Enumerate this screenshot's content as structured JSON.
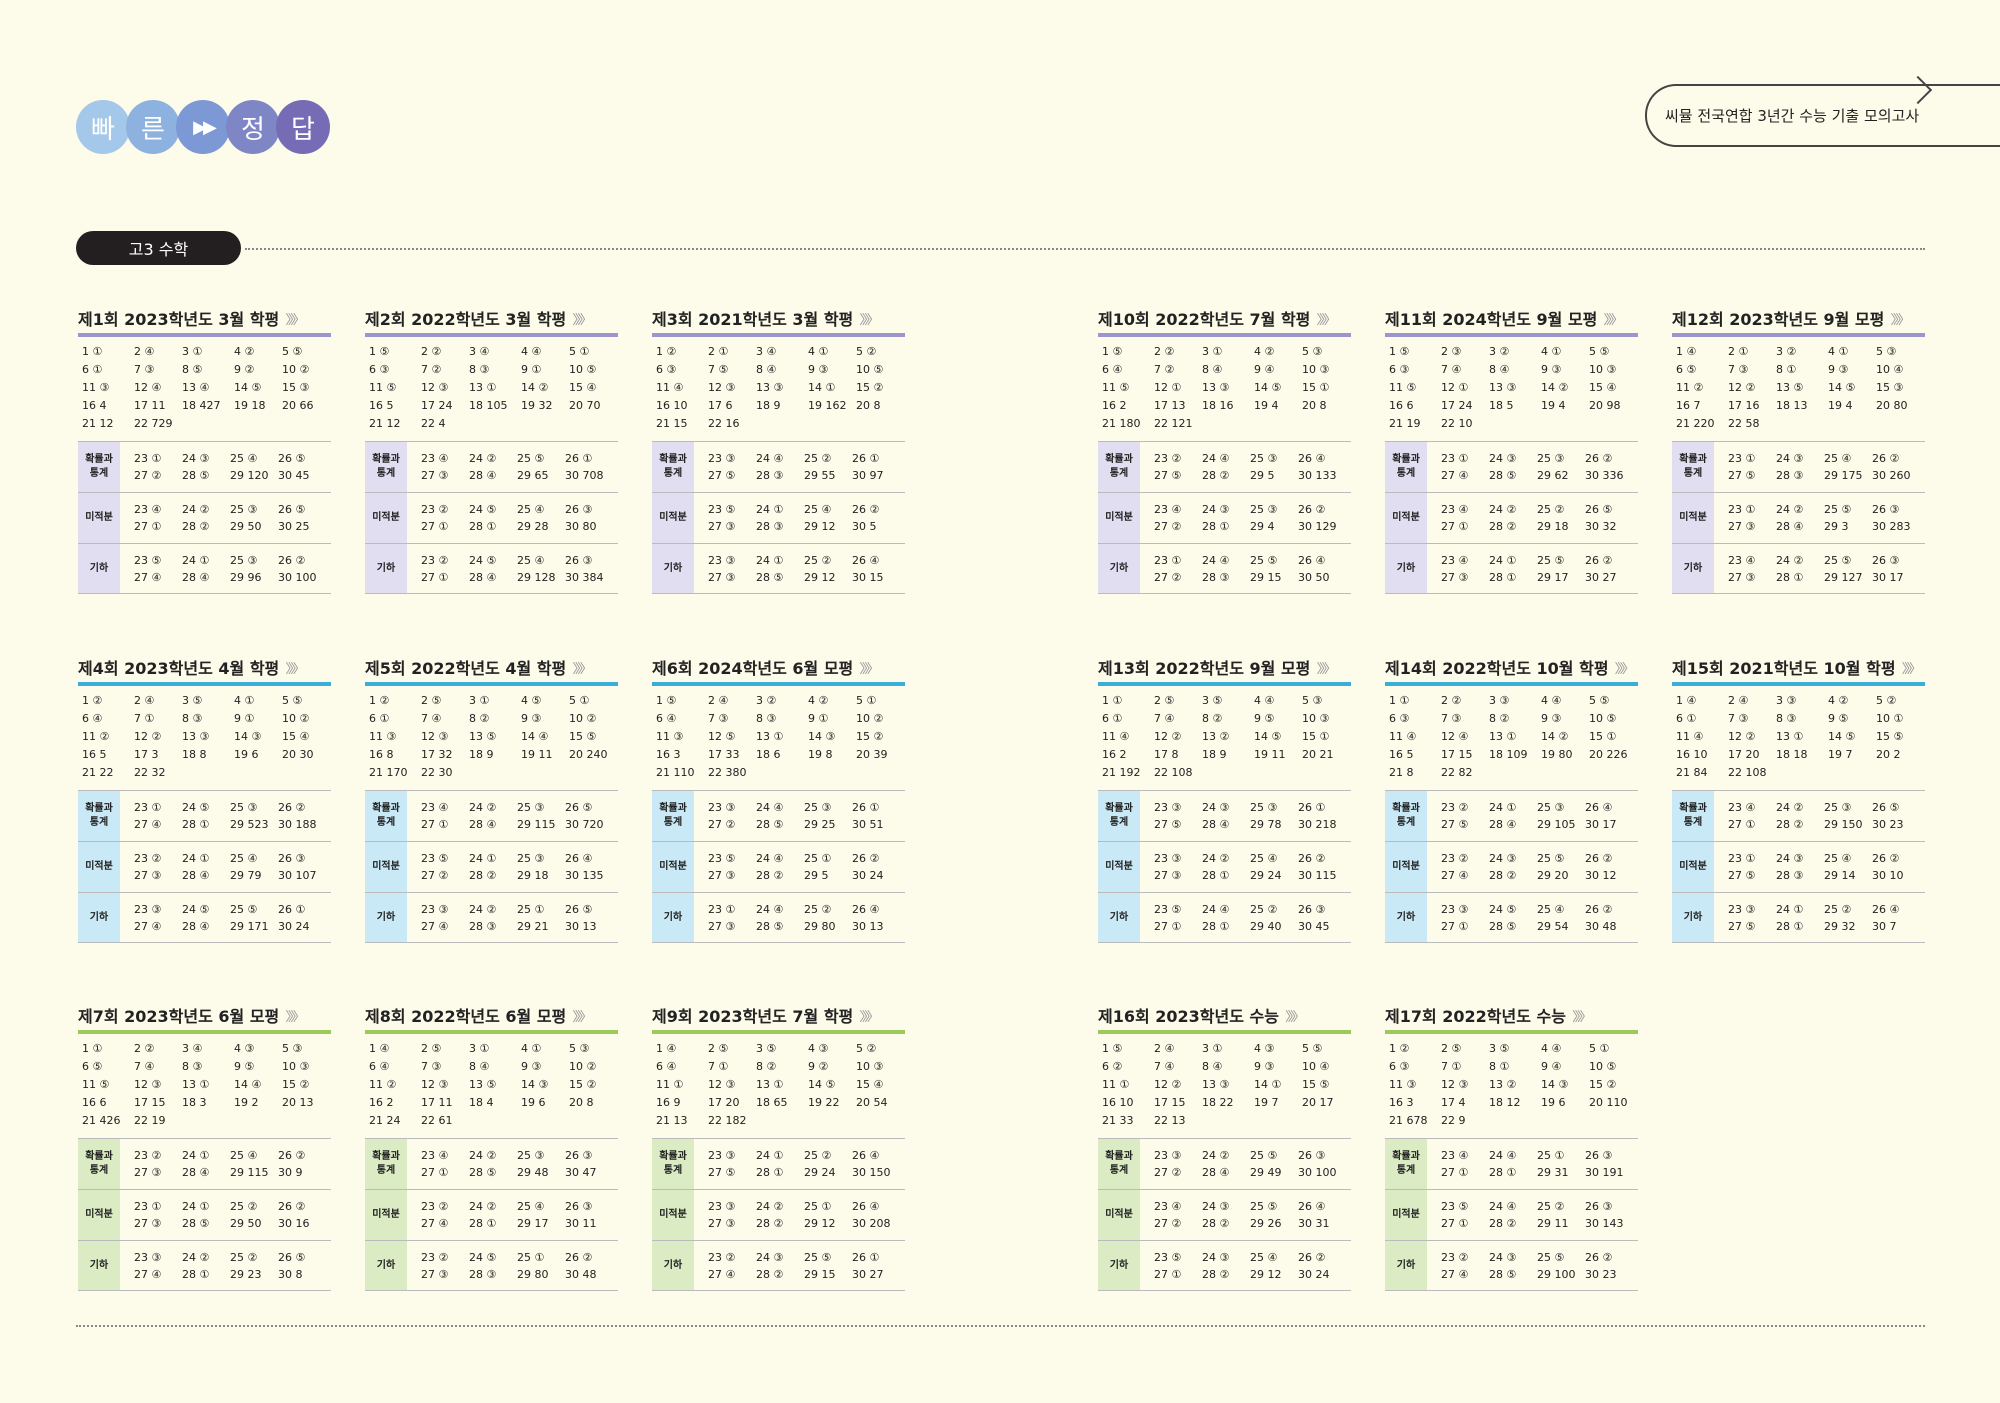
{
  "header": {
    "chars": [
      "빠",
      "른",
      "▶▶",
      "정",
      "답"
    ],
    "series": "씨뮬 전국연합 3년간 수능 기출 모의고사",
    "subject": "고3 수학"
  },
  "labels": {
    "s1": "확률과\n통계",
    "s2": "미적분",
    "s3": "기하"
  },
  "blocks": [
    {
      "title": "제1회 2023학년도 3월 학평",
      "theme": "purple",
      "col": 0,
      "row": 0,
      "common": [
        "1 ①",
        "2 ④",
        "3 ①",
        "4 ②",
        "5 ⑤",
        "6 ①",
        "7 ③",
        "8 ⑤",
        "9 ②",
        "10 ②",
        "11 ③",
        "12 ④",
        "13 ④",
        "14 ⑤",
        "15 ③",
        "16 4",
        "17 11",
        "18 427",
        "19 18",
        "20 66",
        "21 12",
        "22 729"
      ],
      "s1": [
        "23 ①",
        "24 ③",
        "25 ④",
        "26 ⑤",
        "27 ②",
        "28 ⑤",
        "29 120",
        "30 45"
      ],
      "s2": [
        "23 ④",
        "24 ②",
        "25 ③",
        "26 ⑤",
        "27 ①",
        "28 ②",
        "29 50",
        "30 25"
      ],
      "s3": [
        "23 ⑤",
        "24 ①",
        "25 ③",
        "26 ②",
        "27 ④",
        "28 ④",
        "29 96",
        "30 100"
      ]
    },
    {
      "title": "제2회 2022학년도 3월 학평",
      "theme": "purple",
      "col": 1,
      "row": 0,
      "common": [
        "1 ⑤",
        "2 ②",
        "3 ④",
        "4 ④",
        "5 ①",
        "6 ③",
        "7 ②",
        "8 ③",
        "9 ①",
        "10 ⑤",
        "11 ⑤",
        "12 ③",
        "13 ①",
        "14 ②",
        "15 ④",
        "16 5",
        "17 24",
        "18 105",
        "19 32",
        "20 70",
        "21 12",
        "22 4"
      ],
      "s1": [
        "23 ④",
        "24 ②",
        "25 ⑤",
        "26 ①",
        "27 ③",
        "28 ④",
        "29 65",
        "30 708"
      ],
      "s2": [
        "23 ②",
        "24 ⑤",
        "25 ④",
        "26 ③",
        "27 ①",
        "28 ①",
        "29 28",
        "30 80"
      ],
      "s3": [
        "23 ②",
        "24 ⑤",
        "25 ④",
        "26 ③",
        "27 ①",
        "28 ④",
        "29 128",
        "30 384"
      ]
    },
    {
      "title": "제3회 2021학년도 3월 학평",
      "theme": "purple",
      "col": 2,
      "row": 0,
      "common": [
        "1 ②",
        "2 ①",
        "3 ④",
        "4 ①",
        "5 ②",
        "6 ③",
        "7 ⑤",
        "8 ④",
        "9 ③",
        "10 ⑤",
        "11 ④",
        "12 ③",
        "13 ③",
        "14 ①",
        "15 ②",
        "16 10",
        "17 6",
        "18 9",
        "19 162",
        "20 8",
        "21 15",
        "22 16"
      ],
      "s1": [
        "23 ③",
        "24 ④",
        "25 ②",
        "26 ①",
        "27 ⑤",
        "28 ③",
        "29 55",
        "30 97"
      ],
      "s2": [
        "23 ⑤",
        "24 ①",
        "25 ④",
        "26 ②",
        "27 ③",
        "28 ③",
        "29 12",
        "30 5"
      ],
      "s3": [
        "23 ③",
        "24 ①",
        "25 ②",
        "26 ④",
        "27 ③",
        "28 ⑤",
        "29 12",
        "30 15"
      ]
    },
    {
      "title": "제4회 2023학년도 4월 학평",
      "theme": "blue",
      "col": 0,
      "row": 1,
      "common": [
        "1 ②",
        "2 ④",
        "3 ⑤",
        "4 ①",
        "5 ⑤",
        "6 ④",
        "7 ①",
        "8 ③",
        "9 ①",
        "10 ②",
        "11 ②",
        "12 ②",
        "13 ③",
        "14 ③",
        "15 ④",
        "16 5",
        "17 3",
        "18 8",
        "19 6",
        "20 30",
        "21 22",
        "22 32"
      ],
      "s1": [
        "23 ①",
        "24 ⑤",
        "25 ③",
        "26 ②",
        "27 ④",
        "28 ①",
        "29 523",
        "30 188"
      ],
      "s2": [
        "23 ②",
        "24 ①",
        "25 ④",
        "26 ③",
        "27 ③",
        "28 ④",
        "29 79",
        "30 107"
      ],
      "s3": [
        "23 ③",
        "24 ⑤",
        "25 ⑤",
        "26 ①",
        "27 ④",
        "28 ④",
        "29 171",
        "30 24"
      ]
    },
    {
      "title": "제5회 2022학년도 4월 학평",
      "theme": "blue",
      "col": 1,
      "row": 1,
      "common": [
        "1 ②",
        "2 ⑤",
        "3 ①",
        "4 ⑤",
        "5 ①",
        "6 ①",
        "7 ④",
        "8 ②",
        "9 ③",
        "10 ②",
        "11 ③",
        "12 ③",
        "13 ⑤",
        "14 ④",
        "15 ⑤",
        "16 8",
        "17 32",
        "18 9",
        "19 11",
        "20 240",
        "21 170",
        "22 30"
      ],
      "s1": [
        "23 ④",
        "24 ②",
        "25 ③",
        "26 ⑤",
        "27 ①",
        "28 ④",
        "29 115",
        "30 720"
      ],
      "s2": [
        "23 ⑤",
        "24 ①",
        "25 ③",
        "26 ④",
        "27 ②",
        "28 ②",
        "29 18",
        "30 135"
      ],
      "s3": [
        "23 ③",
        "24 ②",
        "25 ①",
        "26 ⑤",
        "27 ④",
        "28 ③",
        "29 21",
        "30 13"
      ]
    },
    {
      "title": "제6회 2024학년도 6월 모평",
      "theme": "blue",
      "col": 2,
      "row": 1,
      "common": [
        "1 ⑤",
        "2 ④",
        "3 ②",
        "4 ②",
        "5 ①",
        "6 ④",
        "7 ③",
        "8 ③",
        "9 ①",
        "10 ②",
        "11 ③",
        "12 ⑤",
        "13 ①",
        "14 ③",
        "15 ②",
        "16 3",
        "17 33",
        "18 6",
        "19 8",
        "20 39",
        "21 110",
        "22 380"
      ],
      "s1": [
        "23 ③",
        "24 ④",
        "25 ③",
        "26 ①",
        "27 ②",
        "28 ⑤",
        "29 25",
        "30 51"
      ],
      "s2": [
        "23 ⑤",
        "24 ④",
        "25 ①",
        "26 ②",
        "27 ③",
        "28 ②",
        "29 5",
        "30 24"
      ],
      "s3": [
        "23 ①",
        "24 ④",
        "25 ②",
        "26 ④",
        "27 ③",
        "28 ⑤",
        "29 80",
        "30 13"
      ]
    },
    {
      "title": "제7회 2023학년도 6월 모평",
      "theme": "green",
      "col": 0,
      "row": 2,
      "common": [
        "1 ①",
        "2 ②",
        "3 ④",
        "4 ③",
        "5 ③",
        "6 ⑤",
        "7 ④",
        "8 ③",
        "9 ⑤",
        "10 ③",
        "11 ⑤",
        "12 ③",
        "13 ①",
        "14 ④",
        "15 ②",
        "16 6",
        "17 15",
        "18 3",
        "19 2",
        "20 13",
        "21 426",
        "22 19"
      ],
      "s1": [
        "23 ②",
        "24 ①",
        "25 ④",
        "26 ②",
        "27 ③",
        "28 ④",
        "29 115",
        "30 9"
      ],
      "s2": [
        "23 ①",
        "24 ①",
        "25 ②",
        "26 ②",
        "27 ③",
        "28 ⑤",
        "29 50",
        "30 16"
      ],
      "s3": [
        "23 ③",
        "24 ②",
        "25 ②",
        "26 ⑤",
        "27 ④",
        "28 ①",
        "29 23",
        "30 8"
      ]
    },
    {
      "title": "제8회 2022학년도 6월 모평",
      "theme": "green",
      "col": 1,
      "row": 2,
      "common": [
        "1 ④",
        "2 ⑤",
        "3 ①",
        "4 ①",
        "5 ③",
        "6 ④",
        "7 ③",
        "8 ④",
        "9 ③",
        "10 ②",
        "11 ②",
        "12 ③",
        "13 ⑤",
        "14 ③",
        "15 ②",
        "16 2",
        "17 11",
        "18 4",
        "19 6",
        "20 8",
        "21 24",
        "22 61"
      ],
      "s1": [
        "23 ④",
        "24 ②",
        "25 ③",
        "26 ③",
        "27 ①",
        "28 ⑤",
        "29 48",
        "30 47"
      ],
      "s2": [
        "23 ②",
        "24 ②",
        "25 ④",
        "26 ③",
        "27 ④",
        "28 ①",
        "29 17",
        "30 11"
      ],
      "s3": [
        "23 ②",
        "24 ⑤",
        "25 ①",
        "26 ②",
        "27 ③",
        "28 ③",
        "29 80",
        "30 48"
      ]
    },
    {
      "title": "제9회 2023학년도 7월 학평",
      "theme": "green",
      "col": 2,
      "row": 2,
      "common": [
        "1 ④",
        "2 ⑤",
        "3 ⑤",
        "4 ③",
        "5 ②",
        "6 ④",
        "7 ①",
        "8 ②",
        "9 ②",
        "10 ③",
        "11 ①",
        "12 ③",
        "13 ①",
        "14 ⑤",
        "15 ④",
        "16 9",
        "17 20",
        "18 65",
        "19 22",
        "20 54",
        "21 13",
        "22 182"
      ],
      "s1": [
        "23 ③",
        "24 ①",
        "25 ②",
        "26 ④",
        "27 ⑤",
        "28 ①",
        "29 24",
        "30 150"
      ],
      "s2": [
        "23 ③",
        "24 ②",
        "25 ①",
        "26 ④",
        "27 ③",
        "28 ②",
        "29 12",
        "30 208"
      ],
      "s3": [
        "23 ②",
        "24 ③",
        "25 ⑤",
        "26 ①",
        "27 ④",
        "28 ②",
        "29 15",
        "30 27"
      ]
    },
    {
      "title": "제10회 2022학년도 7월 학평",
      "theme": "purple",
      "col": 3,
      "row": 0,
      "common": [
        "1 ⑤",
        "2 ②",
        "3 ①",
        "4 ②",
        "5 ③",
        "6 ④",
        "7 ②",
        "8 ④",
        "9 ④",
        "10 ③",
        "11 ⑤",
        "12 ①",
        "13 ③",
        "14 ⑤",
        "15 ①",
        "16 2",
        "17 13",
        "18 16",
        "19 4",
        "20 8",
        "21 180",
        "22 121"
      ],
      "s1": [
        "23 ②",
        "24 ④",
        "25 ③",
        "26 ④",
        "27 ⑤",
        "28 ②",
        "29 5",
        "30 133"
      ],
      "s2": [
        "23 ④",
        "24 ③",
        "25 ③",
        "26 ②",
        "27 ②",
        "28 ①",
        "29 4",
        "30 129"
      ],
      "s3": [
        "23 ①",
        "24 ④",
        "25 ⑤",
        "26 ④",
        "27 ②",
        "28 ③",
        "29 15",
        "30 50"
      ]
    },
    {
      "title": "제11회 2024학년도 9월 모평",
      "theme": "purple",
      "col": 4,
      "row": 0,
      "common": [
        "1 ⑤",
        "2 ③",
        "3 ②",
        "4 ①",
        "5 ⑤",
        "6 ③",
        "7 ④",
        "8 ④",
        "9 ③",
        "10 ③",
        "11 ⑤",
        "12 ①",
        "13 ③",
        "14 ②",
        "15 ④",
        "16 6",
        "17 24",
        "18 5",
        "19 4",
        "20 98",
        "21 19",
        "22 10"
      ],
      "s1": [
        "23 ①",
        "24 ③",
        "25 ③",
        "26 ②",
        "27 ④",
        "28 ⑤",
        "29 62",
        "30 336"
      ],
      "s2": [
        "23 ④",
        "24 ②",
        "25 ②",
        "26 ⑤",
        "27 ①",
        "28 ②",
        "29 18",
        "30 32"
      ],
      "s3": [
        "23 ④",
        "24 ①",
        "25 ⑤",
        "26 ②",
        "27 ③",
        "28 ①",
        "29 17",
        "30 27"
      ]
    },
    {
      "title": "제12회 2023학년도 9월 모평",
      "theme": "purple",
      "col": 5,
      "row": 0,
      "common": [
        "1 ④",
        "2 ①",
        "3 ②",
        "4 ①",
        "5 ③",
        "6 ⑤",
        "7 ③",
        "8 ①",
        "9 ③",
        "10 ④",
        "11 ②",
        "12 ②",
        "13 ⑤",
        "14 ⑤",
        "15 ③",
        "16 7",
        "17 16",
        "18 13",
        "19 4",
        "20 80",
        "21 220",
        "22 58"
      ],
      "s1": [
        "23 ①",
        "24 ③",
        "25 ④",
        "26 ②",
        "27 ⑤",
        "28 ③",
        "29 175",
        "30 260"
      ],
      "s2": [
        "23 ①",
        "24 ②",
        "25 ⑤",
        "26 ③",
        "27 ③",
        "28 ④",
        "29 3",
        "30 283"
      ],
      "s3": [
        "23 ④",
        "24 ②",
        "25 ⑤",
        "26 ③",
        "27 ③",
        "28 ①",
        "29 127",
        "30 17"
      ]
    },
    {
      "title": "제13회 2022학년도 9월 모평",
      "theme": "blue",
      "col": 3,
      "row": 1,
      "common": [
        "1 ①",
        "2 ⑤",
        "3 ⑤",
        "4 ④",
        "5 ③",
        "6 ①",
        "7 ④",
        "8 ②",
        "9 ⑤",
        "10 ③",
        "11 ④",
        "12 ②",
        "13 ②",
        "14 ⑤",
        "15 ①",
        "16 2",
        "17 8",
        "18 9",
        "19 11",
        "20 21",
        "21 192",
        "22 108"
      ],
      "s1": [
        "23 ③",
        "24 ③",
        "25 ③",
        "26 ①",
        "27 ⑤",
        "28 ④",
        "29 78",
        "30 218"
      ],
      "s2": [
        "23 ③",
        "24 ②",
        "25 ④",
        "26 ②",
        "27 ③",
        "28 ①",
        "29 24",
        "30 115"
      ],
      "s3": [
        "23 ⑤",
        "24 ④",
        "25 ②",
        "26 ③",
        "27 ①",
        "28 ①",
        "29 40",
        "30 45"
      ]
    },
    {
      "title": "제14회 2022학년도 10월 학평",
      "theme": "blue",
      "col": 4,
      "row": 1,
      "common": [
        "1 ①",
        "2 ②",
        "3 ③",
        "4 ④",
        "5 ⑤",
        "6 ③",
        "7 ③",
        "8 ②",
        "9 ③",
        "10 ⑤",
        "11 ④",
        "12 ④",
        "13 ①",
        "14 ②",
        "15 ①",
        "16 5",
        "17 15",
        "18 109",
        "19 80",
        "20 226",
        "21 8",
        "22 82"
      ],
      "s1": [
        "23 ②",
        "24 ①",
        "25 ③",
        "26 ④",
        "27 ⑤",
        "28 ④",
        "29 105",
        "30 17"
      ],
      "s2": [
        "23 ②",
        "24 ③",
        "25 ⑤",
        "26 ②",
        "27 ④",
        "28 ②",
        "29 20",
        "30 12"
      ],
      "s3": [
        "23 ③",
        "24 ⑤",
        "25 ④",
        "26 ②",
        "27 ①",
        "28 ⑤",
        "29 54",
        "30 48"
      ]
    },
    {
      "title": "제15회 2021학년도 10월 학평",
      "theme": "blue",
      "col": 5,
      "row": 1,
      "common": [
        "1 ④",
        "2 ④",
        "3 ③",
        "4 ②",
        "5 ②",
        "6 ①",
        "7 ③",
        "8 ③",
        "9 ⑤",
        "10 ①",
        "11 ④",
        "12 ②",
        "13 ①",
        "14 ⑤",
        "15 ⑤",
        "16 10",
        "17 20",
        "18 18",
        "19 7",
        "20 2",
        "21 84",
        "22 108"
      ],
      "s1": [
        "23 ④",
        "24 ②",
        "25 ③",
        "26 ⑤",
        "27 ①",
        "28 ②",
        "29 150",
        "30 23"
      ],
      "s2": [
        "23 ①",
        "24 ③",
        "25 ④",
        "26 ②",
        "27 ⑤",
        "28 ③",
        "29 14",
        "30 10"
      ],
      "s3": [
        "23 ③",
        "24 ①",
        "25 ②",
        "26 ④",
        "27 ⑤",
        "28 ①",
        "29 32",
        "30 7"
      ]
    },
    {
      "title": "제16회 2023학년도 수능",
      "theme": "green",
      "col": 3,
      "row": 2,
      "common": [
        "1 ⑤",
        "2 ④",
        "3 ①",
        "4 ③",
        "5 ⑤",
        "6 ②",
        "7 ④",
        "8 ④",
        "9 ③",
        "10 ④",
        "11 ①",
        "12 ②",
        "13 ③",
        "14 ①",
        "15 ⑤",
        "16 10",
        "17 15",
        "18 22",
        "19 7",
        "20 17",
        "21 33",
        "22 13"
      ],
      "s1": [
        "23 ③",
        "24 ②",
        "25 ⑤",
        "26 ③",
        "27 ②",
        "28 ④",
        "29 49",
        "30 100"
      ],
      "s2": [
        "23 ④",
        "24 ③",
        "25 ⑤",
        "26 ④",
        "27 ②",
        "28 ②",
        "29 26",
        "30 31"
      ],
      "s3": [
        "23 ⑤",
        "24 ③",
        "25 ④",
        "26 ②",
        "27 ①",
        "28 ②",
        "29 12",
        "30 24"
      ]
    },
    {
      "title": "제17회 2022학년도 수능",
      "theme": "green",
      "col": 4,
      "row": 2,
      "common": [
        "1 ②",
        "2 ⑤",
        "3 ⑤",
        "4 ④",
        "5 ①",
        "6 ③",
        "7 ①",
        "8 ①",
        "9 ④",
        "10 ⑤",
        "11 ③",
        "12 ③",
        "13 ②",
        "14 ③",
        "15 ②",
        "16 3",
        "17 4",
        "18 12",
        "19 6",
        "20 110",
        "21 678",
        "22 9"
      ],
      "s1": [
        "23 ④",
        "24 ④",
        "25 ①",
        "26 ③",
        "27 ①",
        "28 ①",
        "29 31",
        "30 191"
      ],
      "s2": [
        "23 ⑤",
        "24 ④",
        "25 ②",
        "26 ③",
        "27 ①",
        "28 ②",
        "29 11",
        "30 143"
      ],
      "s3": [
        "23 ②",
        "24 ③",
        "25 ⑤",
        "26 ②",
        "27 ④",
        "28 ⑤",
        "29 100",
        "30 23"
      ]
    }
  ],
  "colors": {
    "purple": {
      "bar": "#9c96cf",
      "label": "#e1def2"
    },
    "blue": {
      "bar": "#3aaed8",
      "label": "#c9e9f6"
    },
    "green": {
      "bar": "#9bc95a",
      "label": "#dbecc4"
    },
    "circles": [
      "#a4c8ea",
      "#8eb2e0",
      "#7d99d5",
      "#7f86c6",
      "#756cb5"
    ]
  }
}
